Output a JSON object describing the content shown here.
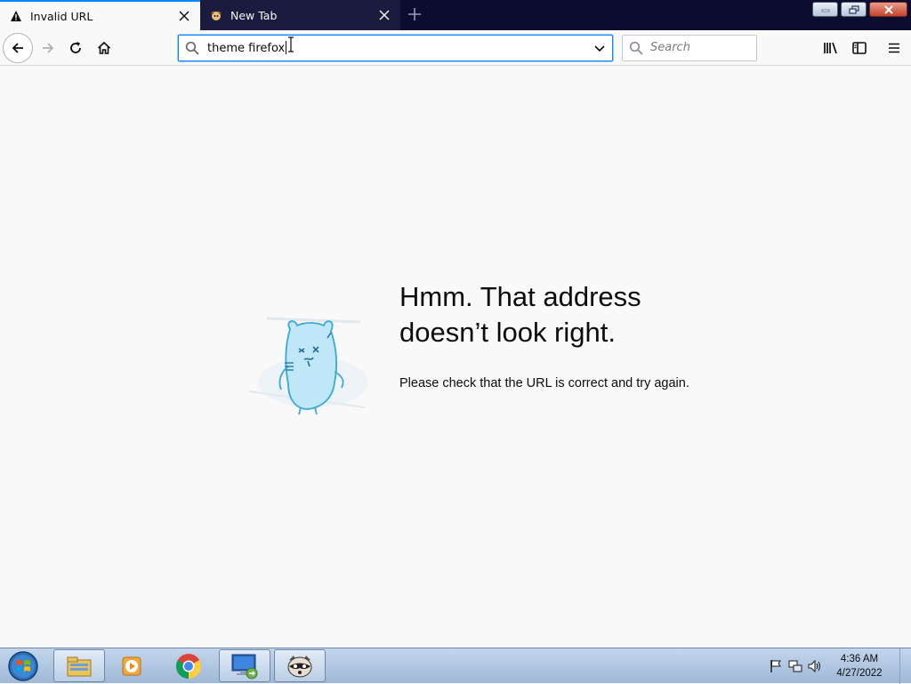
{
  "tabs": [
    {
      "title": "Invalid URL",
      "icon": "warning-icon",
      "active": true
    },
    {
      "title": "New Tab",
      "icon": "firefox-icon",
      "active": false
    }
  ],
  "urlbar": {
    "value": "theme firefox"
  },
  "searchbar": {
    "placeholder": "Search"
  },
  "error": {
    "title_line1": "Hmm. That address",
    "title_line2": "doesn’t look right.",
    "description": "Please check that the URL is correct and try again."
  },
  "taskbar": {
    "time": "4:36 AM",
    "date": "4/27/2022",
    "apps": [
      "windows-explorer-icon",
      "media-player-icon",
      "chrome-icon",
      "remote-desktop-icon",
      "raccoon-app-icon"
    ]
  },
  "colors": {
    "accent": "#0a84ff",
    "tabstrip": "#0c0c2e",
    "page": "#f9f9fa"
  }
}
